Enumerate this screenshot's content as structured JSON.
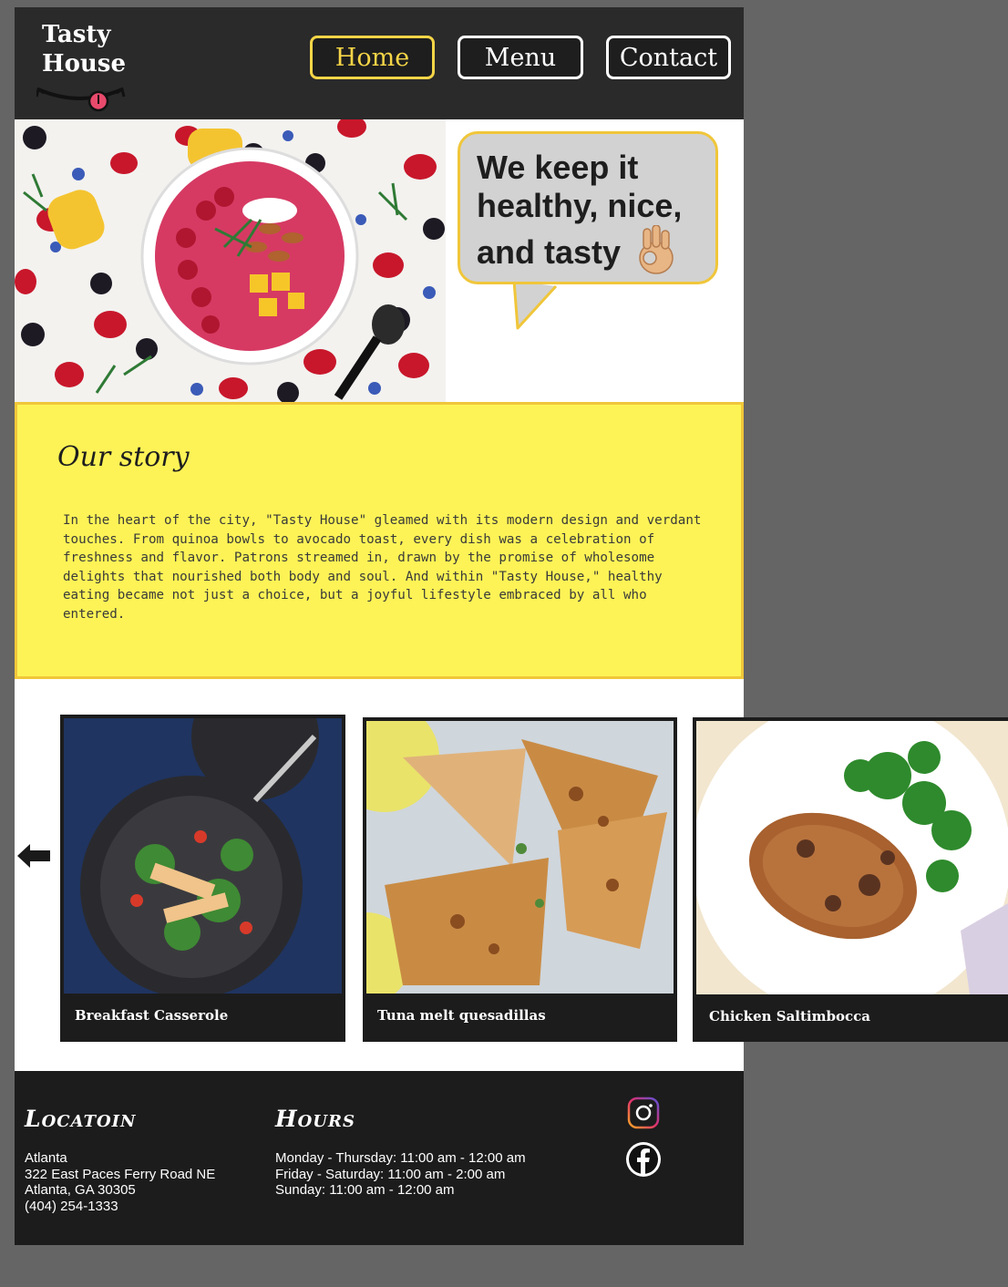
{
  "header": {
    "logo_text": "Tasty\nHouse",
    "nav": [
      {
        "label": "Home",
        "active": true
      },
      {
        "label": "Menu",
        "active": false
      },
      {
        "label": "Contact",
        "active": false
      }
    ]
  },
  "hero": {
    "bubble_text": "We keep it healthy, nice, and tasty"
  },
  "story": {
    "title": "Our story",
    "text": "In the heart of the city, \"Tasty House\" gleamed with its modern design and verdant touches. From quinoa bowls to avocado toast, every dish was a celebration of freshness and flavor. Patrons streamed in, drawn by the promise of wholesome delights that nourished both body and soul. And within \"Tasty House,\" healthy eating became not just a choice, but a joyful lifestyle embraced by all who entered."
  },
  "carousel": {
    "cards": [
      {
        "label": "Breakfast Casserole"
      },
      {
        "label": "Tuna melt quesadillas"
      },
      {
        "label": "Chicken Saltimbocca"
      }
    ]
  },
  "footer": {
    "location_heading": "Locatoin",
    "location_lines": "Atlanta\n322 East Paces Ferry Road NE\nAtlanta, GA 30305\n(404) 254-1333",
    "hours_heading": "Hours",
    "hours_lines": "Monday - Thursday: 11:00 am - 12:00 am\nFriday - Saturday: 11:00 am - 2:00 am\nSunday: 11:00 am - 12:00 am"
  },
  "colors": {
    "header_bg": "#2a2a2a",
    "accent_yellow": "#f5d547",
    "story_bg": "#fdf356",
    "bubble_bg": "#d2d2d2",
    "footer_bg": "#1c1c1c",
    "outer_bg": "#656565"
  },
  "icons": [
    "back-arrow-icon",
    "instagram-icon",
    "facebook-icon",
    "ok-hand-icon",
    "smile-tongue-logo-icon"
  ]
}
